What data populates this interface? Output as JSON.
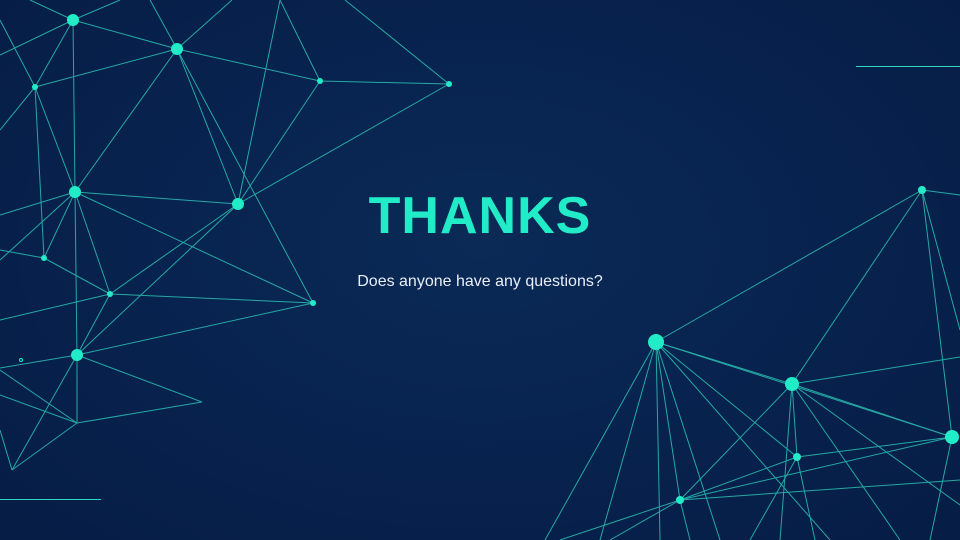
{
  "slide": {
    "title": "THANKS",
    "subtitle": "Does anyone have any questions?"
  },
  "colors": {
    "background": "#082350",
    "accent": "#21ecc7",
    "network_line": "#2fd6c0",
    "subtitle_text": "#e8eef7"
  }
}
